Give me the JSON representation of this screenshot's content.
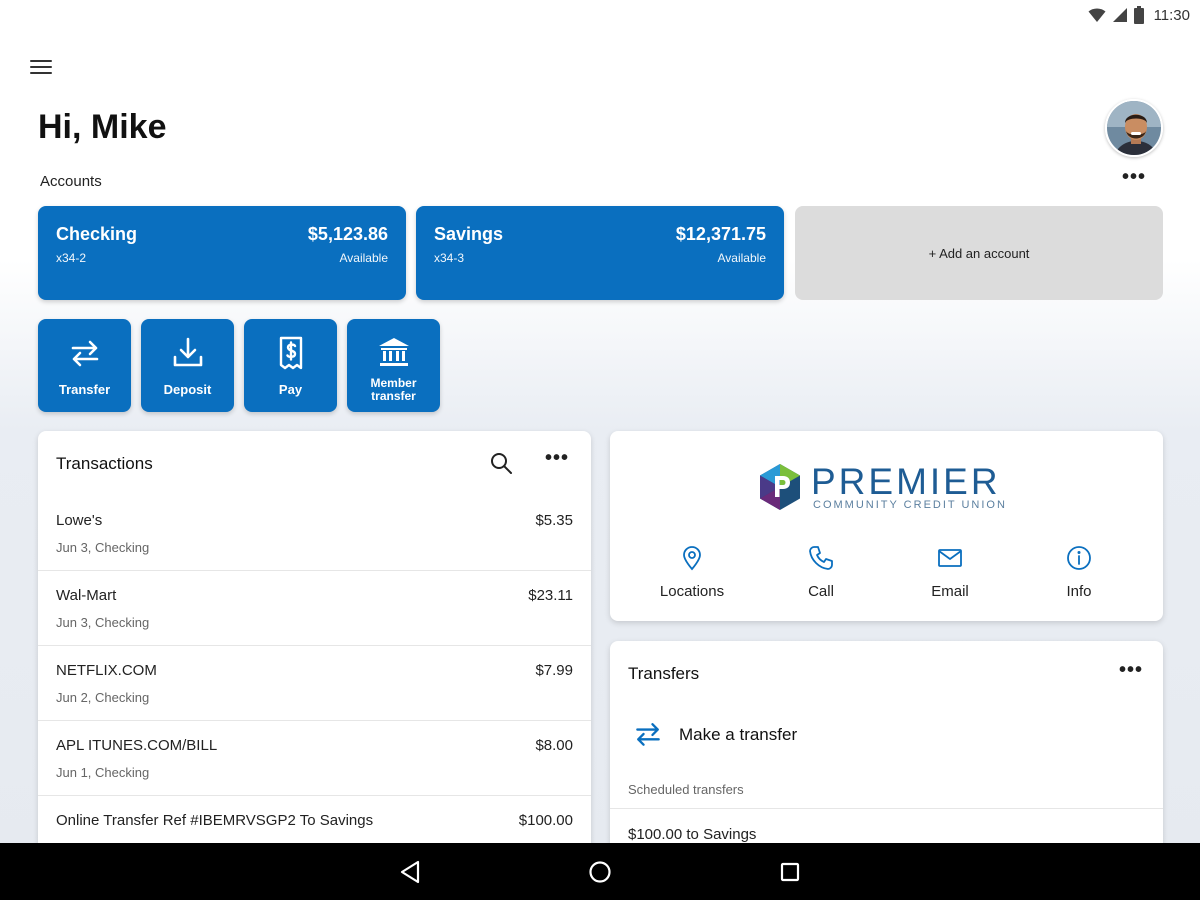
{
  "status": {
    "time": "11:30"
  },
  "header": {
    "greeting": "Hi, Mike"
  },
  "accounts": {
    "label": "Accounts",
    "more": "•••",
    "items": [
      {
        "name": "Checking",
        "number": "x34-2",
        "balance": "$5,123.86",
        "balance_label": "Available"
      },
      {
        "name": "Savings",
        "number": "x34-3",
        "balance": "$12,371.75",
        "balance_label": "Available"
      }
    ],
    "add_label": "+ Add an account"
  },
  "actions": [
    {
      "label": "Transfer",
      "icon": "transfer-icon"
    },
    {
      "label": "Deposit",
      "icon": "deposit-icon"
    },
    {
      "label": "Pay",
      "icon": "pay-icon"
    },
    {
      "label_line1": "Member",
      "label_line2": "transfer",
      "icon": "bank-icon"
    }
  ],
  "transactions": {
    "title": "Transactions",
    "more": "•••",
    "items": [
      {
        "merchant": "Lowe's",
        "meta": "Jun 3, Checking",
        "amount": "$5.35"
      },
      {
        "merchant": "Wal-Mart",
        "meta": "Jun 3, Checking",
        "amount": "$23.11"
      },
      {
        "merchant": "NETFLIX.COM",
        "meta": "Jun 2, Checking",
        "amount": "$7.99"
      },
      {
        "merchant": "APL ITUNES.COM/BILL",
        "meta": "Jun 1, Checking",
        "amount": "$8.00"
      },
      {
        "merchant": "Online Transfer Ref #IBEMRVSGP2 To Savings",
        "meta": "",
        "amount": "$100.00"
      }
    ]
  },
  "credit_union": {
    "name": "PREMIER",
    "subname": "COMMUNITY CREDIT UNION",
    "contacts": [
      {
        "label": "Locations",
        "icon": "location-pin-icon"
      },
      {
        "label": "Call",
        "icon": "phone-icon"
      },
      {
        "label": "Email",
        "icon": "email-icon"
      },
      {
        "label": "Info",
        "icon": "info-icon"
      }
    ]
  },
  "transfers": {
    "title": "Transfers",
    "more": "•••",
    "make_label": "Make a transfer",
    "scheduled_label": "Scheduled transfers",
    "scheduled_items": [
      "$100.00 to Savings"
    ]
  },
  "colors": {
    "primary": "#0a6fbf",
    "add_card": "#dcdcdc"
  }
}
